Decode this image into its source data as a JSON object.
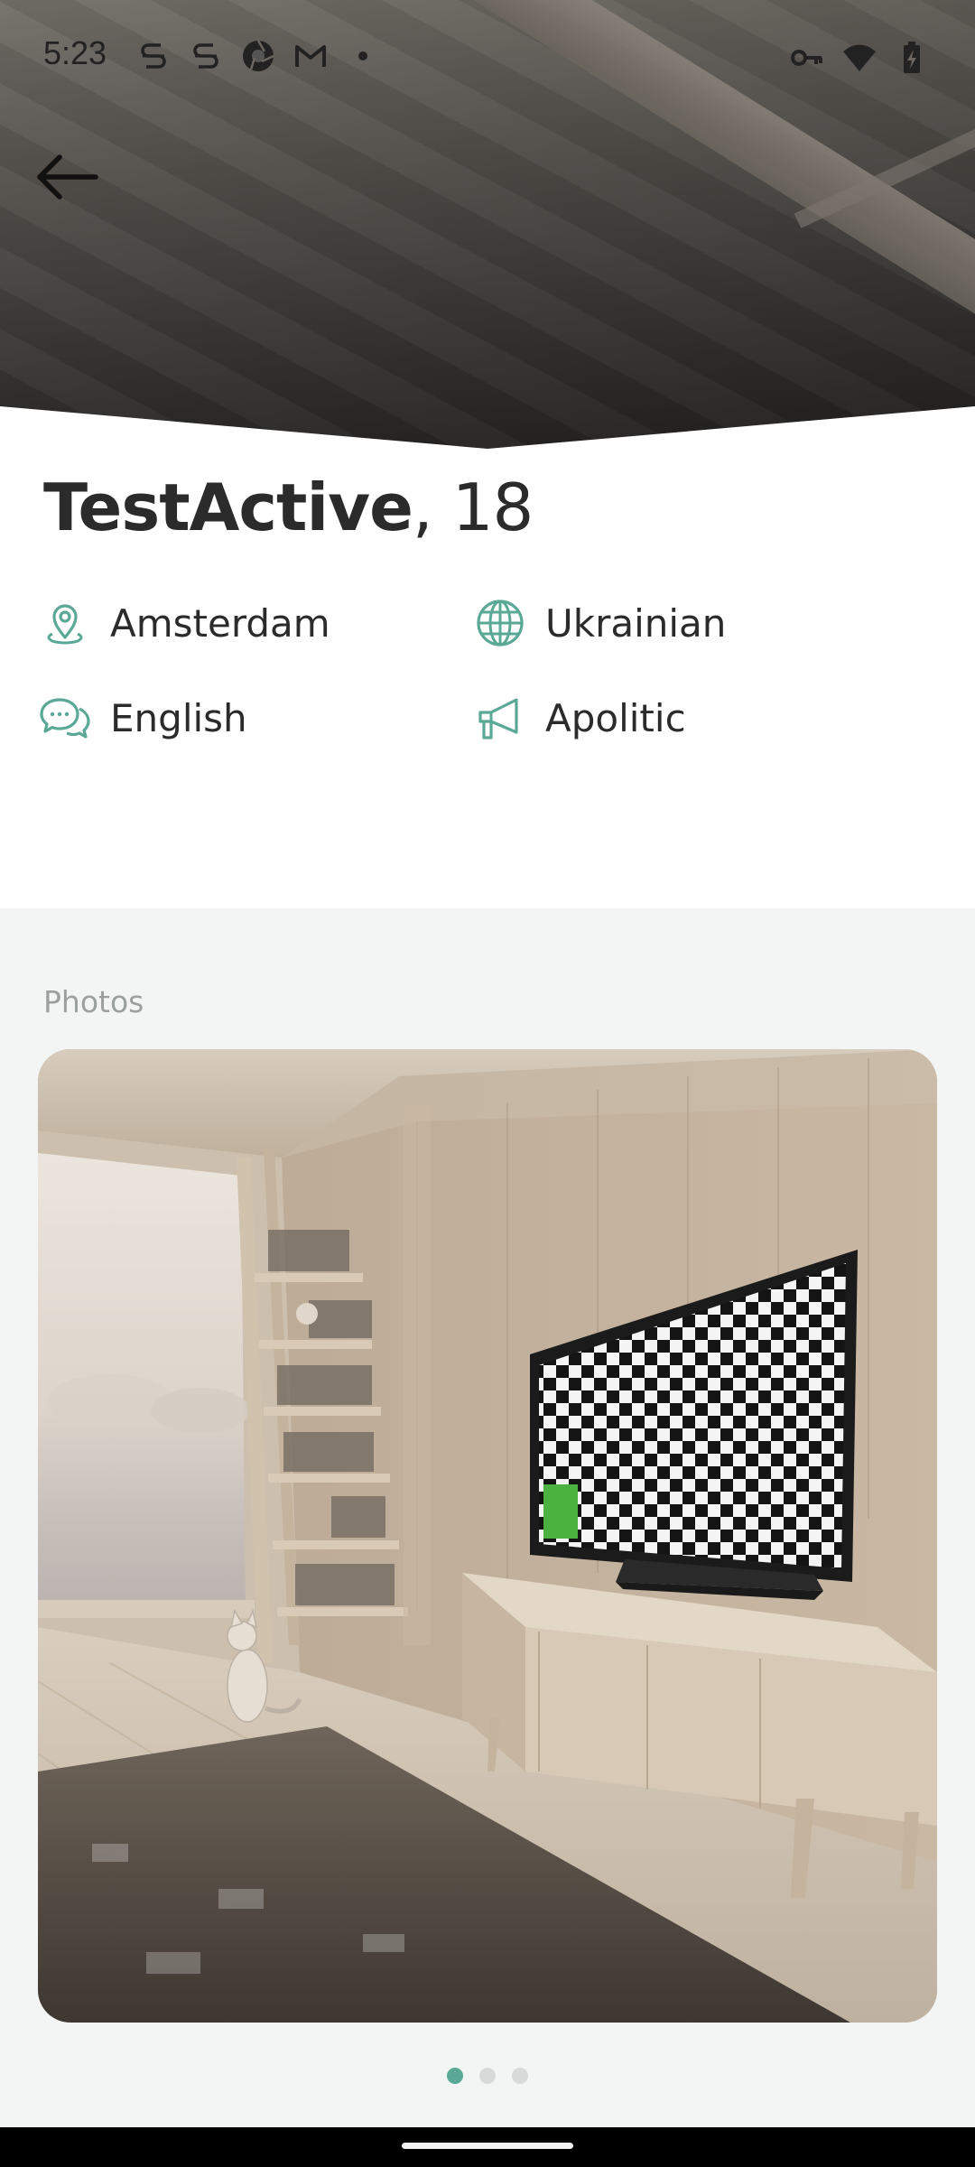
{
  "status_bar": {
    "time": "5:23",
    "left_icons": [
      "s-app-icon",
      "s-app-icon",
      "camera-app-icon",
      "gmail-icon",
      "dot-icon"
    ],
    "right_icons": [
      "vpn-key-icon",
      "wifi-icon",
      "battery-charging-icon"
    ]
  },
  "header": {
    "back_icon": "arrow-left-icon"
  },
  "profile": {
    "name": "TestActive",
    "age_text": ", 18",
    "attributes": [
      {
        "icon": "location-pin-icon",
        "label": "Amsterdam"
      },
      {
        "icon": "globe-icon",
        "label": "Ukrainian"
      },
      {
        "icon": "chat-bubbles-icon",
        "label": "English"
      },
      {
        "icon": "megaphone-icon",
        "label": "Apolitic"
      }
    ]
  },
  "photos": {
    "label": "Photos",
    "count": 3,
    "active_index": 0
  },
  "colors": {
    "accent": "#5aa896",
    "text_primary": "#2b2b2b",
    "text_muted": "#9aa09e",
    "section_bg": "#f2f5f4"
  }
}
